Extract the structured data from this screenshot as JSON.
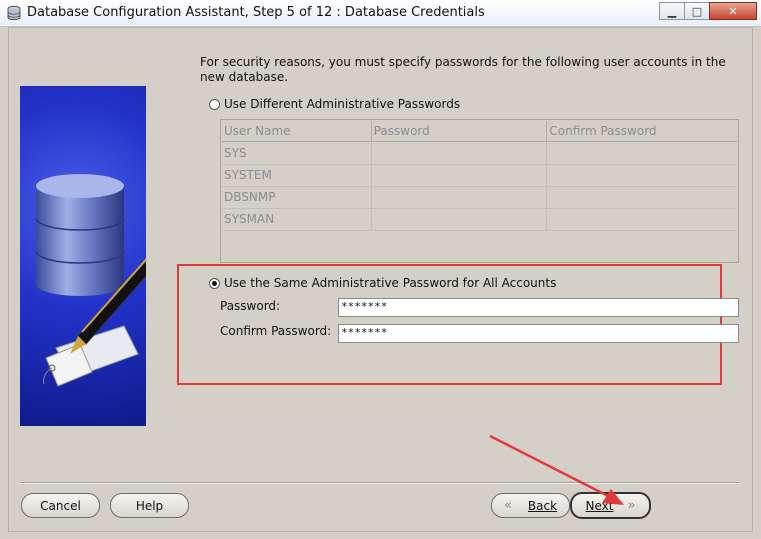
{
  "window": {
    "title": "Database Configuration Assistant, Step 5 of 12 : Database Credentials",
    "minimize_symbol": "▁",
    "maximize_symbol": "□",
    "close_symbol": "✕"
  },
  "intro_text": "For security reasons, you must specify passwords for the following user accounts in the new database.",
  "option_different": {
    "label": "Use Different Administrative Passwords",
    "selected": false
  },
  "users_table": {
    "headers": [
      "User Name",
      "Password",
      "Confirm Password"
    ],
    "rows": [
      {
        "user": "SYS",
        "password": "",
        "confirm": ""
      },
      {
        "user": "SYSTEM",
        "password": "",
        "confirm": ""
      },
      {
        "user": "DBSNMP",
        "password": "",
        "confirm": ""
      },
      {
        "user": "SYSMAN",
        "password": "",
        "confirm": ""
      }
    ],
    "disabled": true
  },
  "option_same": {
    "label": "Use the Same Administrative Password for All Accounts",
    "selected": true,
    "password_label": "Password:",
    "password_value": "*******",
    "confirm_label": "Confirm Password:",
    "confirm_value": "*******"
  },
  "buttons": {
    "cancel": "Cancel",
    "help": "Help",
    "back": "Back",
    "next": "Next",
    "back_icon": "«",
    "next_icon": "»"
  },
  "colors": {
    "highlight_box": "#e03a3a",
    "annotation_arrow": "#e03a3a",
    "side_panel": "#2232c8"
  },
  "icons": [
    "database-app-icon",
    "database-cylinder-icon",
    "fountain-pen-icon",
    "tag-icon"
  ]
}
